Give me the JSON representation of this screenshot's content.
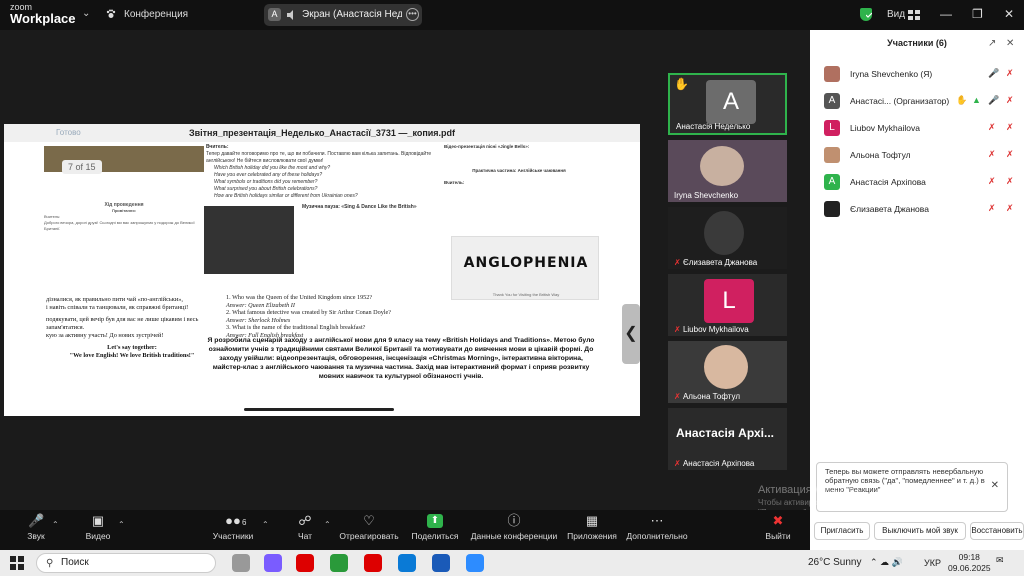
{
  "app": {
    "brand_top": "zoom",
    "brand_bottom": "Workplace",
    "menu": "Конференция"
  },
  "share": {
    "badge": "A",
    "label": "Экран (Анастасія Неделько"
  },
  "top_right": {
    "view": "Вид"
  },
  "document": {
    "done": "Готово",
    "title": "Звітня_презентація_Неделько_Анастасії_3731 —_копия.pdf",
    "page": "7 of 15",
    "bullets": [
      "дізналися, як правильно пити чай «по-англійськи»,",
      "і навіть співали та танцювали, як справжні британці!",
      "подякувати, цей вечір був для вас не лише цікавим і весь",
      "запам'ятатися.",
      "кую за активну участь! До нових зустрічей!",
      "Let's say together:",
      "\"We love English! We love British traditions!\""
    ],
    "quiz": [
      "1. Who was the Queen of the United Kingdom since 1952?",
      "Answer: Queen Elizabeth II",
      "2. What famous detective was created by Sir Arthur Conan Doyle?",
      "Answer: Sherlock Holmes",
      "3. What is the name of the traditional English breakfast?",
      "Answer: Full English breakfast"
    ],
    "paragraph": "Я розробила сценарій заходу з англійської мови для 9 класу на тему «British Holidays and Traditions». Метою було ознайомити учнів з традиційними святами Великої Британії та мотивувати до вивчення мови в цікавій формі. До заходу увійшли: відеопрезентація, обговорення, інсценізація «Christmas Morning», інтерактивна вікторина, майстер-клас з англійського чаювання та музична частина. Захід мав інтерактивний формат і сприяв розвитку мовних навичок та культурної обізнаності учнів.",
    "mid_heading": "Вчитель:",
    "mid_lines": [
      "Тепер давайте поговоримо про те, що ви побачили. Поставлю вам кілька запитань. Відповідайте англійською! Не бійтеся висловлювати свої думки!",
      "Which British holiday did you like the most and why?",
      "Have you ever celebrated any of these holidays?",
      "What symbols or traditions did you remember?",
      "What surprised you about British celebrations?",
      "How are British holidays similar or different from Ukrainian ones?",
      "Музична пауза: «Sing & Dance Like the British»"
    ],
    "right_lines": [
      "Відео-презентація пісні «Jingle Bells»:",
      "Практична частина: Англійське чаювання",
      "Вчитель:",
      "Thank You for Visiting the British Way"
    ],
    "anglo_logo": "ANGLOPHENIA",
    "left_lines": [
      "Хід проведення",
      "Привітання:",
      "Вчитель:",
      "Доброго вечора, дорогі друзі! Сьогодні ми вас запрошуємо у подорож до Великої Британії."
    ]
  },
  "tiles": [
    {
      "name": "Анастасія Неделько",
      "initial": "A",
      "color": "#6c6c6c"
    },
    {
      "name": "Iryna Shevchenko",
      "initial": "",
      "color": "#5a4a5a"
    },
    {
      "name": "Єлизавета Джанова",
      "initial": "",
      "color": "#1e1e1e"
    },
    {
      "name": "Liubov Mykhailova",
      "initial": "L",
      "color": "#d02060"
    },
    {
      "name": "Альона Тофтул",
      "initial": "",
      "color": "#3a3a3a"
    },
    {
      "name": "Анастасія Архіпова",
      "big": "Анастасія Архі...",
      "initial": "",
      "color": "#2a2a2a"
    }
  ],
  "panel": {
    "title": "Участники (6)",
    "participants": [
      {
        "name": "Iryna Shevchenko (Я)",
        "initial": "",
        "color": "#b07060"
      },
      {
        "name": "Анастасі... (Организатор)",
        "initial": "A",
        "color": "#555555"
      },
      {
        "name": "Liubov Mykhailova",
        "initial": "L",
        "color": "#d02060"
      },
      {
        "name": "Альона Тофтул",
        "initial": "",
        "color": "#c09070"
      },
      {
        "name": "Анастасія Архіпова",
        "initial": "A",
        "color": "#2fb34c"
      },
      {
        "name": "Єлизавета Джанова",
        "initial": "",
        "color": "#222222"
      }
    ],
    "notice": "Теперь вы можете отправлять невербальную обратную связь (\"да\", \"помедленнее\" и т. д.) в меню \"Реакции\"",
    "buttons": [
      "Пригласить",
      "Выключить мой звук",
      "Восстановить"
    ]
  },
  "watermark": {
    "title": "Активация Windows",
    "text": "Чтобы активировать Windows, перейдите в раздел \"Параметры\"."
  },
  "toolbar": {
    "audio": "Звук",
    "video": "Видео",
    "participants": "Участники",
    "participants_count": "6",
    "chat": "Чат",
    "react": "Отреагировать",
    "share": "Поделиться",
    "info": "Данные конференции",
    "apps": "Приложения",
    "more": "Дополнительно",
    "leave": "Выйти"
  },
  "taskbar": {
    "search": "Поиск",
    "weather": "26°C  Sunny",
    "lang": "УКР",
    "time": "09:18",
    "date": "09.06.2025"
  },
  "colors": {
    "accent": "#2fb34c",
    "orange": "#e65c00"
  }
}
